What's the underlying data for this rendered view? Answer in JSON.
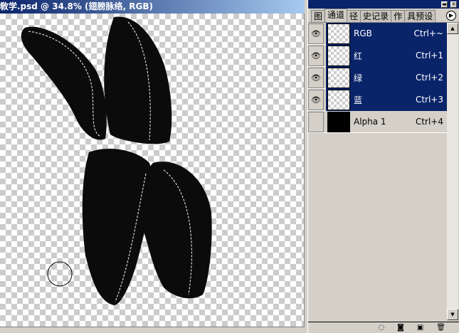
{
  "document": {
    "title": "敎学.psd @ 34.8% (翅膀脉络, RGB)"
  },
  "panel": {
    "tabs": [
      {
        "label": "图"
      },
      {
        "label": "通道"
      },
      {
        "label": "径"
      },
      {
        "label": "史记录"
      },
      {
        "label": "作"
      },
      {
        "label": "具预设"
      }
    ],
    "channels": [
      {
        "name": "RGB",
        "shortcut": "Ctrl+~",
        "visible": true,
        "selected": true
      },
      {
        "name": "红",
        "shortcut": "Ctrl+1",
        "visible": true,
        "selected": true
      },
      {
        "name": "绿",
        "shortcut": "Ctrl+2",
        "visible": true,
        "selected": true
      },
      {
        "name": "蓝",
        "shortcut": "Ctrl+3",
        "visible": true,
        "selected": true
      },
      {
        "name": "Alpha 1",
        "shortcut": "Ctrl+4",
        "visible": false,
        "selected": false
      }
    ],
    "icons": {
      "eye": "eye-icon",
      "menu": "panel-menu-icon",
      "load_selection": "dotted-circle-icon",
      "save_selection": "mask-icon",
      "new_channel": "new-channel-icon",
      "delete": "trash-icon"
    }
  },
  "colors": {
    "selection": "#0a246a",
    "panel": "#d4d0c8"
  }
}
